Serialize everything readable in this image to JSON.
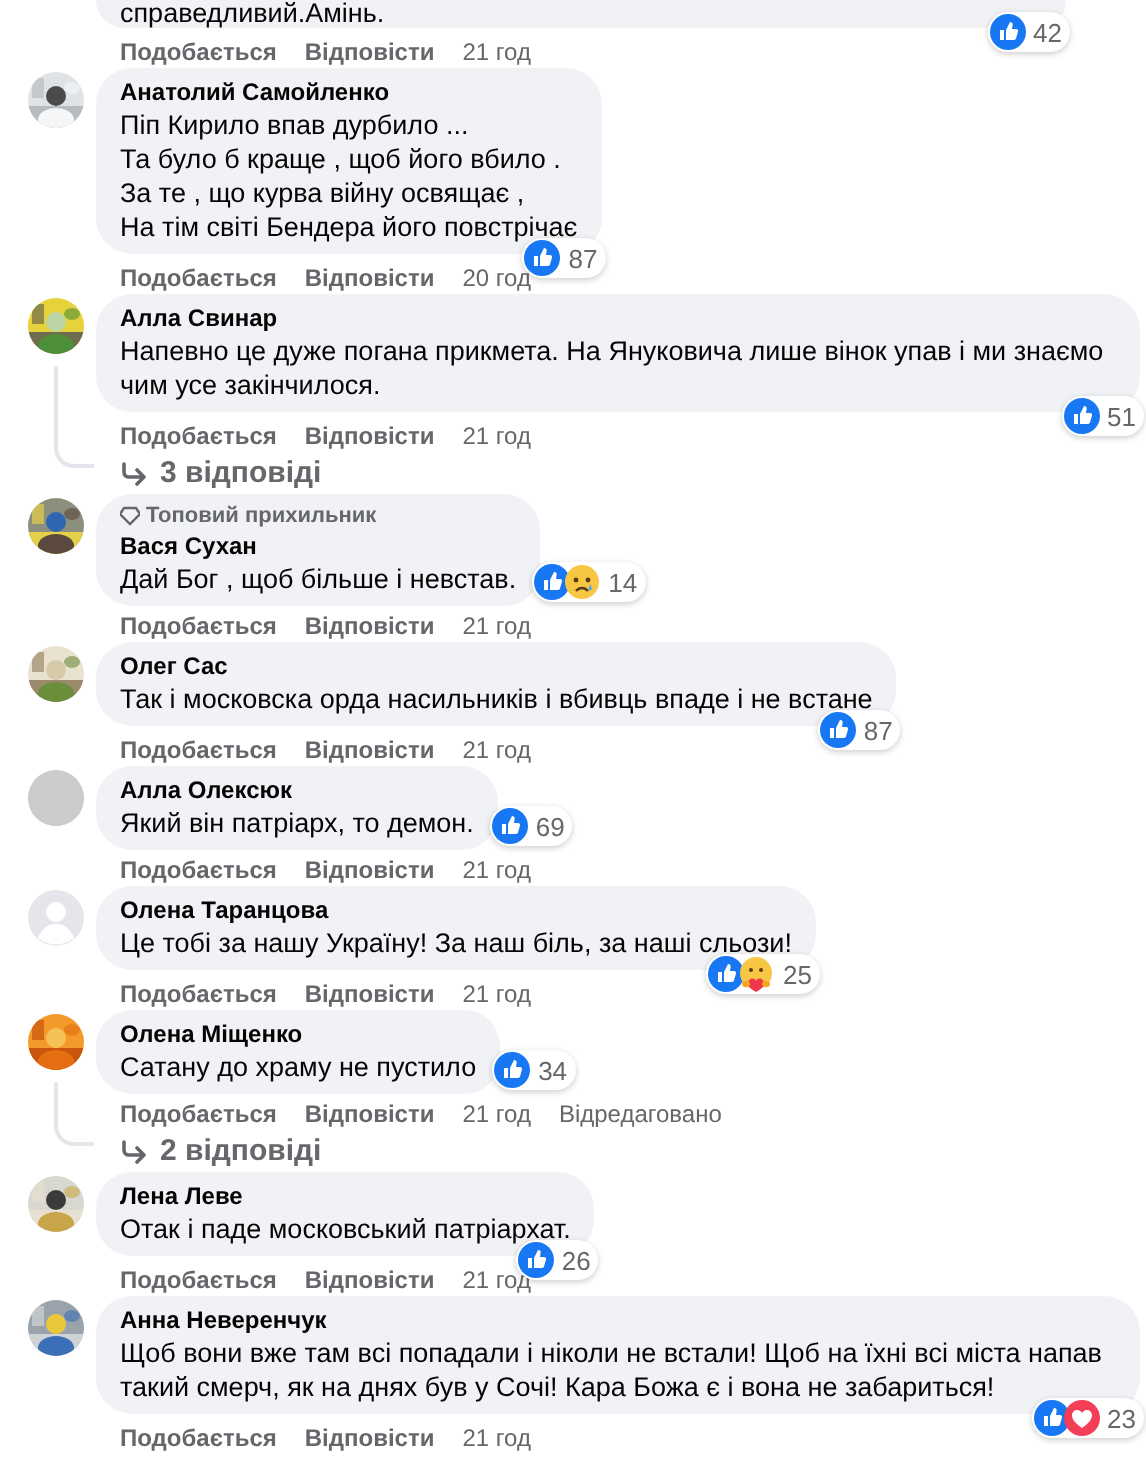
{
  "comments": [
    {
      "text": "справедливий.Амінь.",
      "reactions": {
        "icons": [
          {
            "kind": "like"
          }
        ],
        "count": "42"
      },
      "actions": {
        "like": "Подобається",
        "reply": "Відповісти",
        "time": "21 год"
      }
    },
    {
      "author": "Анатолий Самойленко",
      "text": "Піп Кирило впав дурбило ...\nТа було б краще , щоб його вбило .\nЗа те , що курва війну освящає ,\nНа тім світі Бендера його повстрічає",
      "reactions": {
        "icons": [
          {
            "kind": "like"
          }
        ],
        "count": "87"
      },
      "actions": {
        "like": "Подобається",
        "reply": "Відповісти",
        "time": "20 год"
      }
    },
    {
      "author": "Алла Свинар",
      "text": "Напевно це дуже погана прикмета. На Януковича лише вінок упав і ми знаємо чим усе закінчилося.",
      "reactions": {
        "icons": [
          {
            "kind": "like"
          }
        ],
        "count": "51"
      },
      "actions": {
        "like": "Подобається",
        "reply": "Відповісти",
        "time": "21 год"
      },
      "replies_link": "3 відповіді"
    },
    {
      "badge": "Топовий прихильник",
      "author": "Вася Сухан",
      "text": "Дай Бог , щоб більше і невстав.",
      "reactions": {
        "icons": [
          {
            "kind": "like"
          },
          {
            "kind": "sad"
          }
        ],
        "count": "14"
      },
      "actions": {
        "like": "Подобається",
        "reply": "Відповісти",
        "time": "21 год"
      }
    },
    {
      "author": "Олег Сас",
      "text": "Так і московска орда насильників і вбивць впаде і не встане",
      "reactions": {
        "icons": [
          {
            "kind": "like"
          }
        ],
        "count": "87"
      },
      "actions": {
        "like": "Подобається",
        "reply": "Відповісти",
        "time": "21 год"
      }
    },
    {
      "author": "Алла Олексюк",
      "text": "Який він патріарх, то демон.",
      "reactions": {
        "icons": [
          {
            "kind": "like"
          }
        ],
        "count": "69"
      },
      "actions": {
        "like": "Подобається",
        "reply": "Відповісти",
        "time": "21 год"
      }
    },
    {
      "avatar": {
        "kind": "default"
      },
      "author": "Олена Таранцова",
      "text": "Це тобі за нашу Україну! За наш біль, за наші сльози!",
      "reactions": {
        "icons": [
          {
            "kind": "like"
          },
          {
            "kind": "care"
          }
        ],
        "count": "25"
      },
      "actions": {
        "like": "Подобається",
        "reply": "Відповісти",
        "time": "21 год"
      }
    },
    {
      "author": "Олена Міщенко",
      "text": "Сатану до храму не пустило",
      "reactions": {
        "icons": [
          {
            "kind": "like"
          }
        ],
        "count": "34"
      },
      "actions": {
        "like": "Подобається",
        "reply": "Відповісти",
        "time": "21 год",
        "edited": "Відредаговано"
      },
      "replies_link": "2 відповіді"
    },
    {
      "author": "Лена Леве",
      "text": "Отак і паде московський патріархат.",
      "reactions": {
        "icons": [
          {
            "kind": "like"
          }
        ],
        "count": "26"
      },
      "actions": {
        "like": "Подобається",
        "reply": "Відповісти",
        "time": "21 год"
      }
    },
    {
      "author": "Анна Неверенчук",
      "text": "Щоб вони вже там всі попадали і ніколи не встали! Щоб на їхні всі міста напав такий смерч, як на днях був у Сочі! Кара Божа є і вона не забариться!",
      "reactions": {
        "icons": [
          {
            "kind": "like"
          },
          {
            "kind": "love"
          }
        ],
        "count": "23"
      },
      "actions": {
        "like": "Подобається",
        "reply": "Відповісти",
        "time": "21 год"
      }
    }
  ]
}
